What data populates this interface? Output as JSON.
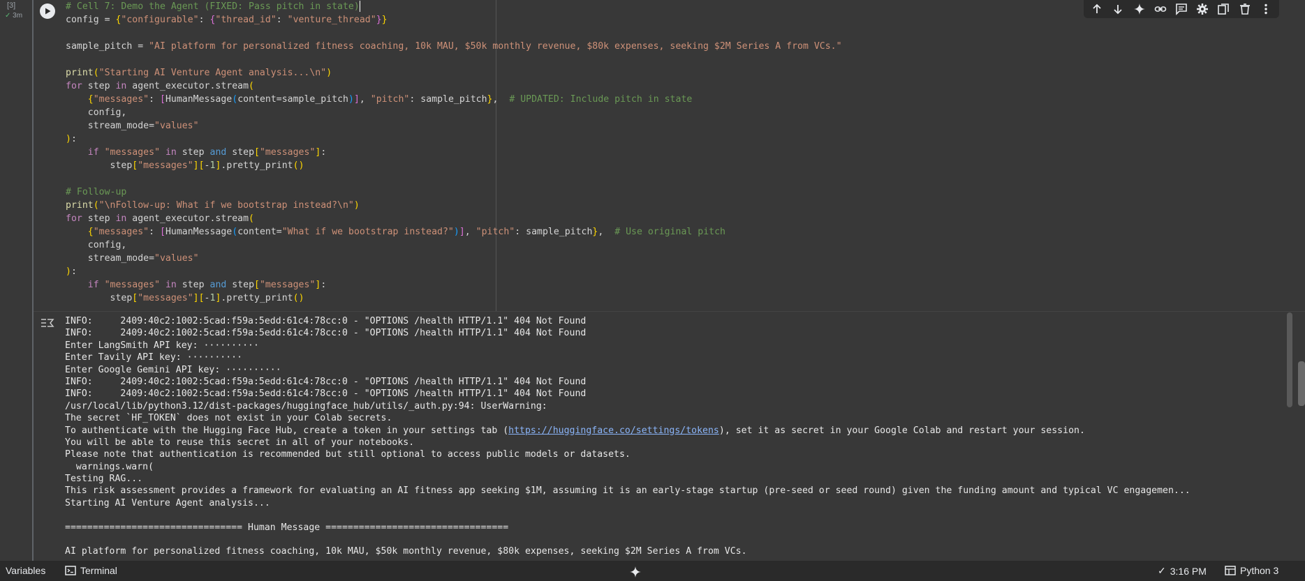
{
  "cell": {
    "execution_count": "[3]",
    "status_time": "3m",
    "code_lines": [
      "# Cell 7: Demo the Agent (FIXED: Pass pitch in state)",
      "config = {\"configurable\": {\"thread_id\": \"venture_thread\"}}",
      "",
      "sample_pitch = \"AI platform for personalized fitness coaching, 10k MAU, $50k monthly revenue, $80k expenses, seeking $2M Series A from VCs.\"",
      "",
      "print(\"Starting AI Venture Agent analysis...\\n\")",
      "for step in agent_executor.stream(",
      "    {\"messages\": [HumanMessage(content=sample_pitch)], \"pitch\": sample_pitch},  # UPDATED: Include pitch in state",
      "    config,",
      "    stream_mode=\"values\"",
      "):",
      "    if \"messages\" in step and step[\"messages\"]:",
      "        step[\"messages\"][-1].pretty_print()",
      "",
      "# Follow-up",
      "print(\"\\nFollow-up: What if we bootstrap instead?\\n\")",
      "for step in agent_executor.stream(",
      "    {\"messages\": [HumanMessage(content=\"What if we bootstrap instead?\")], \"pitch\": sample_pitch},  # Use original pitch",
      "    config,",
      "    stream_mode=\"values\"",
      "):",
      "    if \"messages\" in step and step[\"messages\"]:",
      "        step[\"messages\"][-1].pretty_print()"
    ]
  },
  "toolbar": {
    "icons": [
      "arrow-up-icon",
      "arrow-down-icon",
      "sparkle-icon",
      "link-icon",
      "comment-icon",
      "gear-icon",
      "mirror-cell-icon",
      "trash-icon",
      "more-vert-icon"
    ]
  },
  "output": {
    "lines": [
      "INFO:     2409:40c2:1002:5cad:f59a:5edd:61c4:78cc:0 - \"OPTIONS /health HTTP/1.1\" 404 Not Found",
      "INFO:     2409:40c2:1002:5cad:f59a:5edd:61c4:78cc:0 - \"OPTIONS /health HTTP/1.1\" 404 Not Found",
      "Enter LangSmith API key: ··········",
      "Enter Tavily API key: ··········",
      "Enter Google Gemini API key: ··········",
      "INFO:     2409:40c2:1002:5cad:f59a:5edd:61c4:78cc:0 - \"OPTIONS /health HTTP/1.1\" 404 Not Found",
      "INFO:     2409:40c2:1002:5cad:f59a:5edd:61c4:78cc:0 - \"OPTIONS /health HTTP/1.1\" 404 Not Found",
      "/usr/local/lib/python3.12/dist-packages/huggingface_hub/utils/_auth.py:94: UserWarning: ",
      "The secret `HF_TOKEN` does not exist in your Colab secrets."
    ],
    "auth_line_prefix": "To authenticate with the Hugging Face Hub, create a token in your settings tab (",
    "auth_link": "https://huggingface.co/settings/tokens",
    "auth_line_suffix": "), set it as secret in your Google Colab and restart your session.",
    "lines_after": [
      "You will be able to reuse this secret in all of your notebooks.",
      "Please note that authentication is recommended but still optional to access public models or datasets.",
      "  warnings.warn(",
      "Testing RAG...",
      "This risk assessment provides a framework for evaluating an AI fitness app seeking $1M, assuming it is an early-stage startup (pre-seed or seed round) given the funding amount and typical VC engagemen...",
      "Starting AI Venture Agent analysis...",
      "",
      "================================ Human Message =================================",
      "",
      "AI platform for personalized fitness coaching, 10k MAU, $50k monthly revenue, $80k expenses, seeking $2M Series A from VCs."
    ]
  },
  "statusbar": {
    "variables_label": "Variables",
    "terminal_label": "Terminal",
    "time": "3:16 PM",
    "runtime": "Python 3"
  },
  "colors": {
    "background": "#383838",
    "keyword": "#c586c0",
    "string": "#ce9178",
    "comment": "#6a9955",
    "builtin": "#dcdcaa",
    "link": "#8ab4f8",
    "check": "#5bb974"
  }
}
